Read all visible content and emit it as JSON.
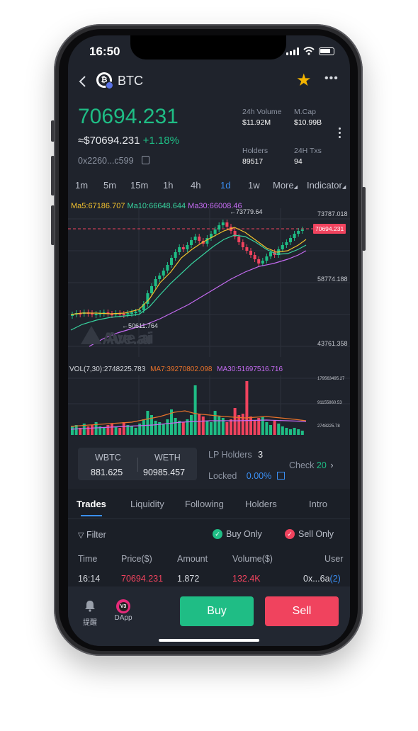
{
  "status": {
    "time": "16:50"
  },
  "header": {
    "coin": "BTC"
  },
  "price": {
    "main": "70694.231",
    "usd": "≈$70694.231",
    "change": "+1.18%",
    "address": "0x2260...c599"
  },
  "stats": [
    {
      "label": "24h Volume",
      "value": "$11.92M"
    },
    {
      "label": "M.Cap",
      "value": "$10.99B"
    },
    {
      "label": "Holders",
      "value": "89517"
    },
    {
      "label": "24H Txs",
      "value": "94"
    }
  ],
  "timeframes": [
    "1m",
    "5m",
    "15m",
    "1h",
    "4h",
    "1d",
    "1w",
    "More",
    "Indicator"
  ],
  "active_timeframe": "1d",
  "ma": {
    "ma5": "Ma5:67186.707",
    "ma10": "Ma10:66648.644",
    "ma30": "Ma30:66008.46"
  },
  "chart_labels": {
    "high": "←73779.64",
    "low": "←50611.764",
    "current": "70694.231",
    "watermark": "Ave.ai",
    "y_ticks": [
      "73787.018",
      "58774.188",
      "43761.358"
    ]
  },
  "volume": {
    "vol": "VOL(7,30):2748225.783",
    "ma7": "MA7:39270802.098",
    "ma30": "MA30:51697516.716",
    "y_ticks": [
      "179563495.27",
      "91155860.53",
      "2748225.78"
    ]
  },
  "chart_data": {
    "type": "candlestick",
    "y_axis": [
      43761.358,
      73787.018
    ],
    "current_price": 70694.231,
    "high_marker": 73779.64,
    "low_marker": 50611.764
  },
  "pool": {
    "token_a": "WBTC",
    "token_a_value": "881.625",
    "token_b": "WETH",
    "token_b_value": "90985.457",
    "lp_holders_label": "LP Holders",
    "lp_holders": "3",
    "locked_label": "Locked",
    "locked_value": "0.00%",
    "check_label": "Check",
    "check_value": "20"
  },
  "tabs": [
    "Trades",
    "Liquidity",
    "Following",
    "Holders",
    "Intro"
  ],
  "filter": {
    "label": "Filter",
    "buy_only": "Buy Only",
    "sell_only": "Sell Only"
  },
  "table": {
    "headers": [
      "Time",
      "Price($)",
      "Amount",
      "Volume($)",
      "User"
    ],
    "rows": [
      {
        "time": "16:14",
        "price": "70694.231",
        "amount": "1.872",
        "volume": "132.4K",
        "user": "0x...6a",
        "user_count": "(2)"
      }
    ]
  },
  "bottom": {
    "alert_label": "提醒",
    "dapp_label": "DApp",
    "dapp_badge": "V3",
    "buy": "Buy",
    "sell": "Sell"
  },
  "colors": {
    "green": "#1fbd85",
    "red": "#f0435e",
    "accent": "#3a8ef2",
    "bg": "#1f232c"
  }
}
